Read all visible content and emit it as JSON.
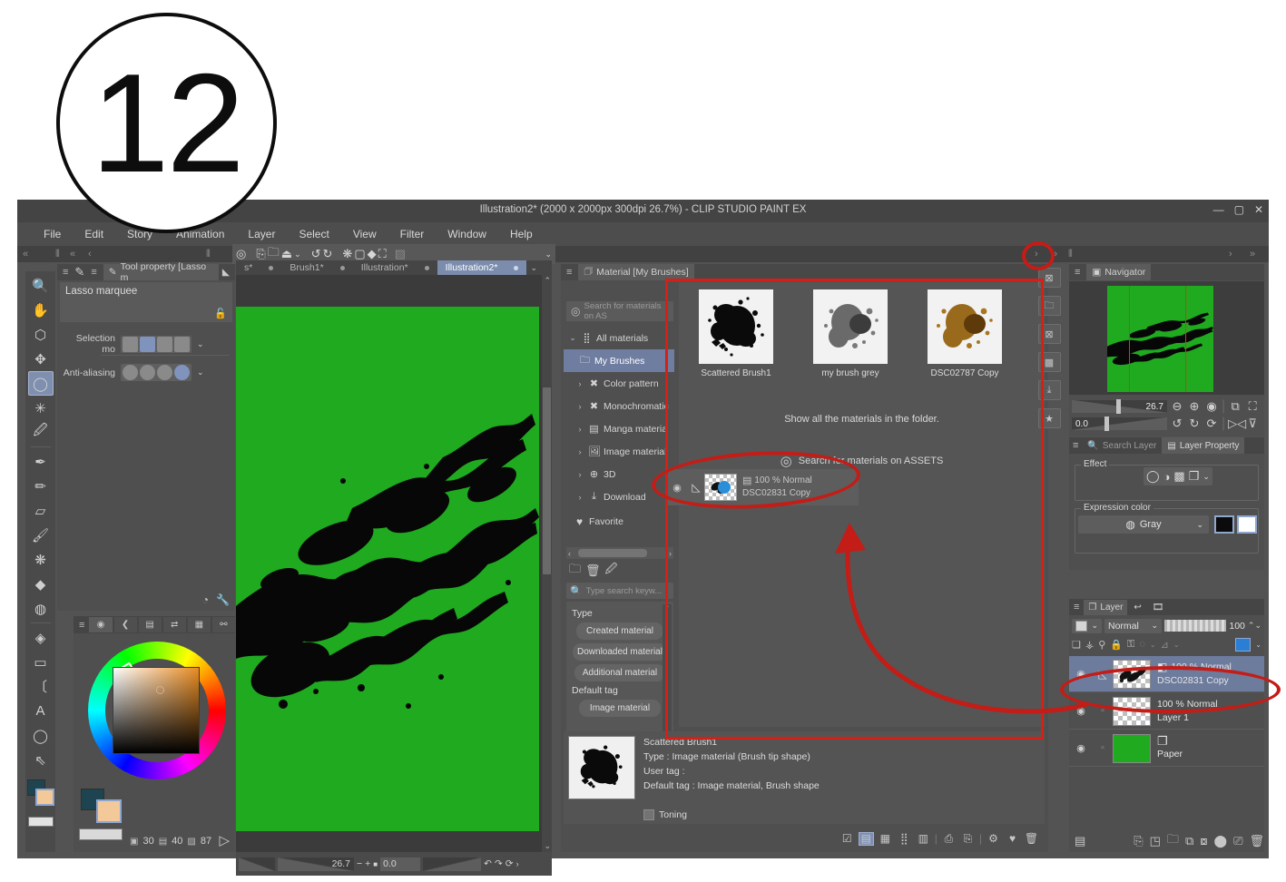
{
  "annotation": {
    "step_badge": "12"
  },
  "window": {
    "title": "Illustration2* (2000 x 2000px 300dpi 26.7%)  - CLIP STUDIO PAINT EX",
    "minimize": "—",
    "maximize": "▢",
    "close": "✕"
  },
  "menu": {
    "items": [
      "File",
      "Edit",
      "Story",
      "Animation",
      "Layer",
      "Select",
      "View",
      "Filter",
      "Window",
      "Help"
    ]
  },
  "toolbar_icons": [
    "spiral-icon",
    "new-doc-icon",
    "open-folder-icon",
    "save-icon",
    "caret-down-icon",
    "undo-icon",
    "redo-icon",
    "selection-dots-icon",
    "clear-icon",
    "fill-icon",
    "crop-icon",
    "deselect-icon",
    "caret-down2-icon"
  ],
  "tool_palette": {
    "tools": [
      {
        "name": "zoom-tool",
        "glyph": "🔍",
        "selected": false
      },
      {
        "name": "hand-tool",
        "glyph": "✋",
        "selected": false
      },
      {
        "name": "rotate-tool",
        "glyph": "⬡",
        "selected": false
      },
      {
        "name": "move-tool",
        "glyph": "✥",
        "selected": false
      },
      {
        "name": "lasso-selection-tool",
        "glyph": "◯",
        "selected": true
      },
      {
        "name": "auto-select-tool",
        "glyph": "✳",
        "selected": false
      },
      {
        "name": "eyedropper-tool",
        "glyph": "🖉",
        "selected": false
      },
      {
        "name": "pen-tool",
        "glyph": "✒",
        "selected": false
      },
      {
        "name": "pencil-tool",
        "glyph": "✏",
        "selected": false
      },
      {
        "name": "eraser-tool",
        "glyph": "▱",
        "selected": false
      },
      {
        "name": "airbrush-tool",
        "glyph": "🖌",
        "selected": false
      },
      {
        "name": "blend-tool",
        "glyph": "❋",
        "selected": false
      },
      {
        "name": "fill-tool",
        "glyph": "◆",
        "selected": false
      },
      {
        "name": "gradient-tool",
        "glyph": "◍",
        "selected": false
      },
      {
        "name": "shape-tool",
        "glyph": "◈",
        "selected": false
      },
      {
        "name": "frame-tool",
        "glyph": "▭",
        "selected": false
      },
      {
        "name": "ruler-tool",
        "glyph": "〔",
        "selected": false
      },
      {
        "name": "text-tool",
        "glyph": "A",
        "selected": false
      },
      {
        "name": "balloon-tool",
        "glyph": "◯",
        "selected": false
      },
      {
        "name": "correct-line-tool",
        "glyph": "⇖",
        "selected": false
      }
    ]
  },
  "tool_property": {
    "palette_title": "Tool property [Lasso m",
    "tool_name": "Lasso marquee",
    "rows": [
      {
        "label": "Selection mo",
        "options": [
          "square",
          "add",
          "subtract",
          "intersect"
        ],
        "selected": 1
      },
      {
        "label": "Anti-aliasing",
        "options": [
          "none",
          "weak",
          "medium",
          "strong"
        ],
        "selected": 3
      }
    ]
  },
  "color_wheel": {
    "tabs": [
      "color-wheel-tab",
      "color-slider-tab",
      "color-set-tab",
      "intermediate-color-tab",
      "approx-color-tab",
      "color-history-tab"
    ],
    "values": [
      {
        "icon": "hue-icon",
        "value": "30"
      },
      {
        "icon": "saturation-icon",
        "value": "40"
      },
      {
        "icon": "value-icon",
        "value": "87"
      }
    ]
  },
  "document_tabs": {
    "tabs": [
      {
        "label": "s*",
        "active": false
      },
      {
        "label": "Brush1*",
        "active": false
      },
      {
        "label": "Illustration*",
        "active": false
      },
      {
        "label": "Illustration2*",
        "active": true
      }
    ]
  },
  "canvas_status": {
    "zoom": "26.7",
    "minus": "−",
    "plus": "+",
    "stop": "■",
    "rotation": "0.0"
  },
  "material_palette": {
    "palette_title": "Material [My Brushes]",
    "search_assets_placeholder": "Search for materials on AS",
    "tree": [
      {
        "label": "All materials",
        "icon": "grid-icon",
        "expanded": true,
        "selected": false,
        "indent": 0
      },
      {
        "label": "My Brushes",
        "icon": "folder-icon",
        "expanded": false,
        "selected": true,
        "indent": 1
      },
      {
        "label": "Color pattern",
        "icon": "color-pattern-icon",
        "expanded": false,
        "selected": false,
        "indent": 1
      },
      {
        "label": "Monochromatic",
        "icon": "monochrome-icon",
        "expanded": false,
        "selected": false,
        "indent": 1
      },
      {
        "label": "Manga materia",
        "icon": "manga-icon",
        "expanded": false,
        "selected": false,
        "indent": 1
      },
      {
        "label": "Image material",
        "icon": "image-icon",
        "expanded": false,
        "selected": false,
        "indent": 1
      },
      {
        "label": "3D",
        "icon": "cube-icon",
        "expanded": false,
        "selected": false,
        "indent": 1
      },
      {
        "label": "Download",
        "icon": "download-icon",
        "expanded": false,
        "selected": false,
        "indent": 1
      },
      {
        "label": "Favorite",
        "icon": "heart-icon",
        "expanded": false,
        "selected": false,
        "indent": 1
      }
    ],
    "folder_buttons": [
      "new-folder-icon",
      "delete-folder-icon",
      "edit-folder-icon"
    ],
    "keyword_search_placeholder": "Type search keyw...",
    "tag_sections": [
      {
        "heading": "Type",
        "pills": [
          "Created material",
          "Downloaded material",
          "Additional material"
        ]
      },
      {
        "heading": "Default tag",
        "pills": [
          "Image material"
        ]
      }
    ],
    "thumbnails": [
      {
        "label": "Scattered Brush1",
        "tone": "black"
      },
      {
        "label": "my brush grey",
        "tone": "grey"
      },
      {
        "label": "DSC02787 Copy",
        "tone": "brown"
      }
    ],
    "show_all_text": "Show all the materials in the folder.",
    "assets_link": "Search for materials on ASSETS",
    "overlay_layer": {
      "opacity_blend": "100 % Normal",
      "name": "DSC02831 Copy"
    },
    "info": {
      "name": "Scattered Brush1",
      "type": "Type : Image material (Brush tip shape)",
      "user_tag": "User tag :",
      "default_tag": "Default tag : Image material, Brush shape",
      "toning": "Toning"
    },
    "bottom_icons": [
      "check-material-icon",
      "detail-view-icon",
      "large-thumb-icon",
      "small-thumb-icon",
      "list-view-icon",
      "paste-material-icon",
      "copy-material-icon",
      "settings-icon",
      "favorite-icon",
      "trash-icon"
    ]
  },
  "icon_strip": [
    "close-folder-icon",
    "save-folder-icon",
    "delete-folder-icon",
    "pattern-folder-icon",
    "download-folder-icon",
    "favorite-folder-icon"
  ],
  "navigator": {
    "palette_title": "Navigator",
    "zoom_value": "26.7",
    "rotation_value": "0.0",
    "zoom_icons": [
      "zoom-out-icon",
      "zoom-in-icon",
      "fit-icon",
      "flip-icon",
      "fullscreen-icon"
    ],
    "rot_icons": [
      "rotate-left-icon",
      "rotate-right-icon",
      "reset-rotate-icon",
      "flip-h-icon",
      "flip-v-icon"
    ]
  },
  "layer_property": {
    "tabs": [
      {
        "label": "Search Layer",
        "active": false
      },
      {
        "label": "Layer Property",
        "active": true
      }
    ],
    "effect_legend": "Effect",
    "effect_icons": [
      "border-effect-icon",
      "tone-effect-icon",
      "halftone-icon",
      "layer-color-icon",
      "chevron-down-icon"
    ],
    "expression_legend": "Expression color",
    "expression_value": "Gray",
    "swatch_main": "#000000",
    "swatch_sub": "#ffffff"
  },
  "layer_palette": {
    "tabs": [
      {
        "label": "Layer",
        "icon": "layers-icon",
        "active": true
      },
      {
        "label": "",
        "icon": "history-icon",
        "active": false
      },
      {
        "label": "",
        "icon": "animation-icon",
        "active": false
      }
    ],
    "blend_mode": "Normal",
    "opacity": "100",
    "toolbar_icons": [
      "clip-below-icon",
      "mask-icon",
      "ruler-link-icon",
      "lock-icon",
      "lock-transparency-icon",
      "mask-enable-icon",
      "ruler-show-icon",
      "palette-color-icon"
    ],
    "layers": [
      {
        "name": "DSC02831 Copy",
        "blend": "100 % Normal",
        "selected": true,
        "thumb": "brush",
        "visible": true
      },
      {
        "name": "Layer 1",
        "blend": "100 % Normal",
        "selected": false,
        "thumb": "transparent",
        "visible": true
      },
      {
        "name": "Paper",
        "blend": "",
        "selected": false,
        "thumb": "green",
        "visible": true
      }
    ],
    "bottom_icons": [
      "palette-icon",
      "new-raster-icon",
      "new-vector-icon",
      "new-folder-icon",
      "transfer-down-icon",
      "combine-down-icon",
      "mask-icon",
      "clip-icon",
      "delete-layer-icon"
    ]
  },
  "colors": {
    "canvas_green": "#1faa1f",
    "annotation_red": "#c41c16",
    "accent_blue": "#7f93bd",
    "panel_bg": "#4f4f4f"
  }
}
